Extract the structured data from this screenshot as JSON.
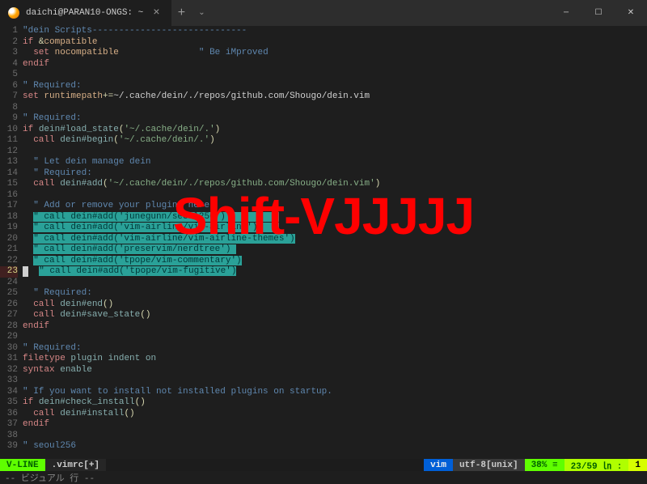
{
  "window": {
    "tab_title": "daichi@PARAN10-ONGS: ~",
    "tab_close": "×",
    "new_tab": "+",
    "dropdown": "⌄",
    "minimize": "─",
    "maximize": "☐",
    "close": "✕"
  },
  "editor": {
    "overlay": "Shift-VJJJJJ",
    "current_line": 23,
    "mode_line": "-- ビジュアル 行 --",
    "lines": [
      {
        "n": 1,
        "seg": [
          [
            "c-comment",
            "\"dein Scripts-----------------------------"
          ]
        ]
      },
      {
        "n": 2,
        "seg": [
          [
            "c-keyword",
            "if"
          ],
          [
            "",
            " "
          ],
          [
            "c-op",
            "&"
          ],
          [
            "c-option",
            "compatible"
          ]
        ]
      },
      {
        "n": 3,
        "seg": [
          [
            "",
            "  "
          ],
          [
            "c-keyword",
            "set"
          ],
          [
            "",
            " "
          ],
          [
            "c-option",
            "nocompatible"
          ],
          [
            "",
            "               "
          ],
          [
            "c-comment",
            "\" Be iMproved"
          ]
        ]
      },
      {
        "n": 4,
        "seg": [
          [
            "c-keyword",
            "endif"
          ]
        ]
      },
      {
        "n": 5,
        "seg": [
          [
            "",
            ""
          ]
        ]
      },
      {
        "n": 6,
        "seg": [
          [
            "c-comment",
            "\" Required:"
          ]
        ]
      },
      {
        "n": 7,
        "seg": [
          [
            "c-keyword",
            "set"
          ],
          [
            "",
            " "
          ],
          [
            "c-option",
            "runtimepath"
          ],
          [
            "c-op",
            "+="
          ],
          [
            "",
            "~/.cache/dein/./repos/github.com/Shougo/dein.vim"
          ]
        ]
      },
      {
        "n": 8,
        "seg": [
          [
            "",
            ""
          ]
        ]
      },
      {
        "n": 9,
        "seg": [
          [
            "c-comment",
            "\" Required:"
          ]
        ]
      },
      {
        "n": 10,
        "seg": [
          [
            "c-keyword",
            "if"
          ],
          [
            "",
            " "
          ],
          [
            "c-func",
            "dein#load_state"
          ],
          [
            "c-op",
            "("
          ],
          [
            "c-string",
            "'~/.cache/dein/.'"
          ],
          [
            "c-op",
            ")"
          ]
        ]
      },
      {
        "n": 11,
        "seg": [
          [
            "",
            "  "
          ],
          [
            "c-keyword",
            "call"
          ],
          [
            "",
            " "
          ],
          [
            "c-func",
            "dein#begin"
          ],
          [
            "c-op",
            "("
          ],
          [
            "c-string",
            "'~/.cache/dein/.'"
          ],
          [
            "c-op",
            ")"
          ]
        ]
      },
      {
        "n": 12,
        "seg": [
          [
            "",
            ""
          ]
        ]
      },
      {
        "n": 13,
        "seg": [
          [
            "",
            "  "
          ],
          [
            "c-comment",
            "\" Let dein manage dein"
          ]
        ]
      },
      {
        "n": 14,
        "seg": [
          [
            "",
            "  "
          ],
          [
            "c-comment",
            "\" Required:"
          ]
        ]
      },
      {
        "n": 15,
        "seg": [
          [
            "",
            "  "
          ],
          [
            "c-keyword",
            "call"
          ],
          [
            "",
            " "
          ],
          [
            "c-func",
            "dein#add"
          ],
          [
            "c-op",
            "("
          ],
          [
            "c-string",
            "'~/.cache/dein/./repos/github.com/Shougo/dein.vim'"
          ],
          [
            "c-op",
            ")"
          ]
        ]
      },
      {
        "n": 16,
        "seg": [
          [
            "",
            ""
          ]
        ]
      },
      {
        "n": 17,
        "seg": [
          [
            "",
            "  "
          ],
          [
            "c-comment",
            "\" Add or remove your plugins here"
          ]
        ]
      },
      {
        "n": 18,
        "seg": [
          [
            "",
            "  "
          ],
          [
            "visual",
            "\" call dein#add('junegunn/seoul256')          "
          ]
        ]
      },
      {
        "n": 19,
        "seg": [
          [
            "",
            "  "
          ],
          [
            "visual",
            "\" call dein#add('vim-airline/vim-airline')    "
          ]
        ]
      },
      {
        "n": 20,
        "seg": [
          [
            "",
            "  "
          ],
          [
            "visual",
            "\" call dein#add('vim-airline/vim-airline-themes')"
          ]
        ]
      },
      {
        "n": 21,
        "seg": [
          [
            "",
            "  "
          ],
          [
            "visual",
            "\" call dein#add('preservim/nerdtree') "
          ]
        ]
      },
      {
        "n": 22,
        "seg": [
          [
            "",
            "  "
          ],
          [
            "visual",
            "\" call dein#add('tpope/vim-commentary')"
          ]
        ]
      },
      {
        "n": 23,
        "seg": [
          [
            "",
            "  "
          ],
          [
            "visual",
            "\" call dein#add('tpope/vim-fugitive')"
          ]
        ],
        "cursor": true
      },
      {
        "n": 24,
        "seg": [
          [
            "",
            ""
          ]
        ]
      },
      {
        "n": 25,
        "seg": [
          [
            "",
            "  "
          ],
          [
            "c-comment",
            "\" Required:"
          ]
        ]
      },
      {
        "n": 26,
        "seg": [
          [
            "",
            "  "
          ],
          [
            "c-keyword",
            "call"
          ],
          [
            "",
            " "
          ],
          [
            "c-func",
            "dein#end"
          ],
          [
            "c-op",
            "("
          ],
          [
            "c-op",
            ")"
          ]
        ]
      },
      {
        "n": 27,
        "seg": [
          [
            "",
            "  "
          ],
          [
            "c-keyword",
            "call"
          ],
          [
            "",
            " "
          ],
          [
            "c-func",
            "dein#save_state"
          ],
          [
            "c-op",
            "("
          ],
          [
            "c-op",
            ")"
          ]
        ]
      },
      {
        "n": 28,
        "seg": [
          [
            "c-keyword",
            "endif"
          ]
        ]
      },
      {
        "n": 29,
        "seg": [
          [
            "",
            ""
          ]
        ]
      },
      {
        "n": 30,
        "seg": [
          [
            "c-comment",
            "\" Required:"
          ]
        ]
      },
      {
        "n": 31,
        "seg": [
          [
            "c-keyword",
            "filetype"
          ],
          [
            "",
            " "
          ],
          [
            "c-builtin",
            "plugin"
          ],
          [
            "",
            " "
          ],
          [
            "c-builtin",
            "indent"
          ],
          [
            "",
            " "
          ],
          [
            "c-builtin",
            "on"
          ]
        ]
      },
      {
        "n": 32,
        "seg": [
          [
            "c-keyword",
            "syntax"
          ],
          [
            "",
            " "
          ],
          [
            "c-builtin",
            "enable"
          ]
        ]
      },
      {
        "n": 33,
        "seg": [
          [
            "",
            ""
          ]
        ]
      },
      {
        "n": 34,
        "seg": [
          [
            "c-comment",
            "\" If you want to install not installed plugins on startup."
          ]
        ]
      },
      {
        "n": 35,
        "seg": [
          [
            "c-keyword",
            "if"
          ],
          [
            "",
            " "
          ],
          [
            "c-func",
            "dein#check_install"
          ],
          [
            "c-op",
            "("
          ],
          [
            "c-op",
            ")"
          ]
        ]
      },
      {
        "n": 36,
        "seg": [
          [
            "",
            "  "
          ],
          [
            "c-keyword",
            "call"
          ],
          [
            "",
            " "
          ],
          [
            "c-func",
            "dein#install"
          ],
          [
            "c-op",
            "("
          ],
          [
            "c-op",
            ")"
          ]
        ]
      },
      {
        "n": 37,
        "seg": [
          [
            "c-keyword",
            "endif"
          ]
        ]
      },
      {
        "n": 38,
        "seg": [
          [
            "",
            ""
          ]
        ]
      },
      {
        "n": 39,
        "seg": [
          [
            "c-comment",
            "\" seoul256"
          ]
        ]
      }
    ]
  },
  "status": {
    "mode": "V-LINE",
    "file": ".vimrc[+]",
    "filetype": "vim",
    "encoding": "utf-8[unix]",
    "percent": "38% ≡",
    "position": "23/59 ㏑ :",
    "col": "1"
  }
}
